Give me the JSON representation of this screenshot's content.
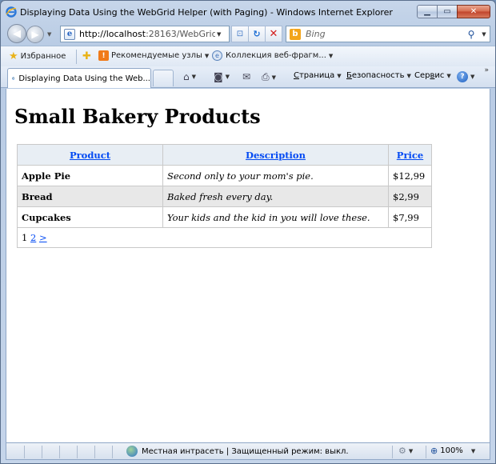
{
  "window": {
    "title": "Displaying Data Using the WebGrid Helper (with Paging) - Windows Internet Explorer"
  },
  "address_bar": {
    "url_host": "http://localhost",
    "url_rest": ":28163/WebGridPagir",
    "search_placeholder": "Bing"
  },
  "favorites_bar": {
    "favorites_label": "Избранное",
    "suggested_sites": "Рекомендуемые узлы",
    "web_slice_gallery": "Коллекция веб-фрагм..."
  },
  "tab": {
    "label": "Displaying Data Using the Web..."
  },
  "command_bar": {
    "page_prefix": "С",
    "page_rest": "траница",
    "safety_prefix": "Б",
    "safety_rest": "езопасность",
    "tools_pre": "Сер",
    "tools_u": "в",
    "tools_post": "ис"
  },
  "page": {
    "heading": "Small Bakery Products",
    "grid": {
      "columns": [
        "Product",
        "Description",
        "Price"
      ],
      "rows": [
        {
          "product": "Apple Pie",
          "description": "Second only to your mom's pie.",
          "price": "$12,99"
        },
        {
          "product": "Bread",
          "description": "Baked fresh every day.",
          "price": "$2,99"
        },
        {
          "product": "Cupcakes",
          "description": "Your kids and the kid in you will love these.",
          "price": "$7,99"
        }
      ],
      "pager": {
        "current": "1",
        "next_page": "2",
        "next_arrow": ">"
      }
    }
  },
  "status_bar": {
    "zone_text": "Местная интрасеть | Защищенный режим: выкл.",
    "zoom": "100%"
  },
  "colors": {
    "link": "#034af3",
    "alt_row": "#e8e8e8",
    "header_bg": "#e8eef4"
  }
}
